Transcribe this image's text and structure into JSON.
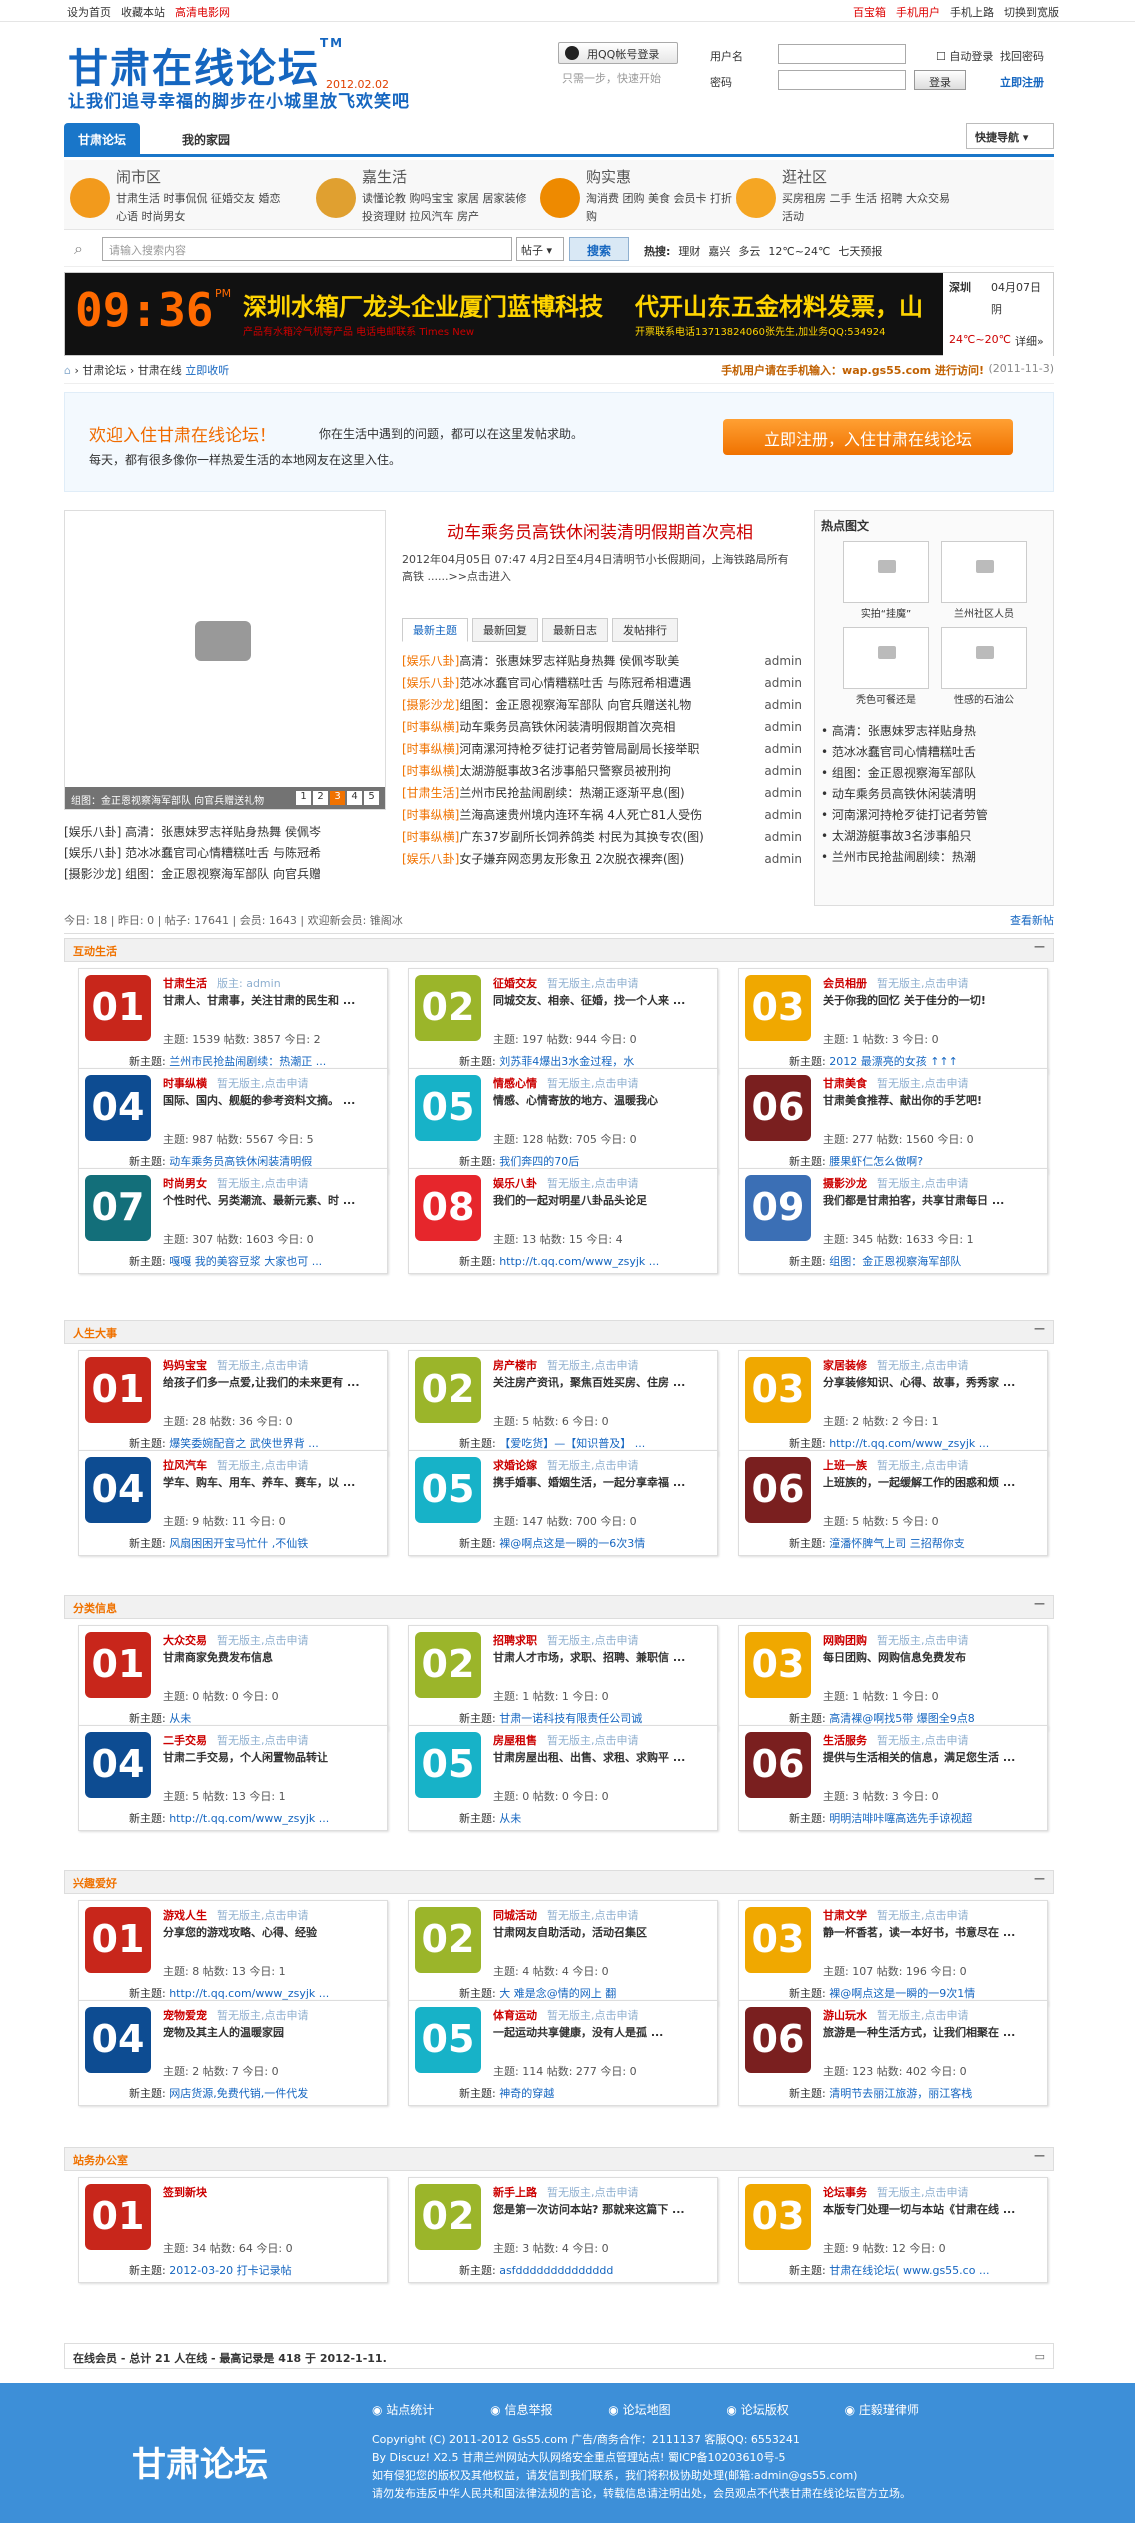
{
  "topbar": {
    "set_home": "设为首页",
    "fav": "收藏本站",
    "movie": "高清电影网",
    "box": "百宝箱",
    "mobile": "手机用户",
    "hand": "手机上路",
    "wide": "切换到宽版"
  },
  "header": {
    "logo": "甘肃在线论坛",
    "tm": "TM",
    "date": "2012.02.02",
    "slogan": "让我们追寻幸福的脚步在小城里放飞欢笑吧",
    "qq_btn": "用QQ帐号登录",
    "qq_sub": "只需一步，快速开始",
    "user_label": "用户名",
    "pwd_label": "密码",
    "auto": "自动登录",
    "find_pwd": "找回密码",
    "login": "登录",
    "register": "立即注册"
  },
  "nav": {
    "tab1": "甘肃论坛",
    "tab2": "我的家园",
    "quick": "快捷导航"
  },
  "cats": [
    {
      "title": "闹市区",
      "items": "甘肃生活 时事侃侃 征婚交友 婚恋心语 时尚男女"
    },
    {
      "title": "嘉生活",
      "items": "读懂论教 购吗宝宝 家居 居家装修 投资理财 拉风汽车 房产"
    },
    {
      "title": "购实惠",
      "items": "淘消费 团购 美食 会员卡 打折 网购"
    },
    {
      "title": "逛社区",
      "items": "买房租房 二手 生活 招聘 大众交易 活动"
    }
  ],
  "search": {
    "placeholder": "请输入搜索内容",
    "select": "帖子",
    "button": "搜索",
    "hot_label": "热搜:",
    "hot": [
      "理财",
      "嘉兴",
      "多云",
      "12℃~24℃",
      "七天预报"
    ]
  },
  "banner": {
    "clock": "09:36",
    "pm": "PM",
    "t1": "深圳水箱厂龙头企业厦门蓝博科技",
    "t2": "产品有水箱冷气机等产品 电话电邮联系 Times New",
    "t3": "代开山东五金材料发票，山",
    "t4": "开票联系电话13713824060张先生,加业务QQ:534924",
    "weather_city": "深圳",
    "weather_date": "04月07日",
    "weather": "阴",
    "temp": "24℃~20℃",
    "detail": "详细»"
  },
  "crumb": {
    "home": "甘肃论坛",
    "forum": "甘肃在线",
    "fav": "立即收听",
    "mobile": "手机用户请在手机输入：wap.gs55.com 进行访问!",
    "date": "(2011-11-3)"
  },
  "welcome": {
    "w1": "欢迎入住甘肃在线论坛！",
    "w2": "你在生活中遇到的问题，都可以在这里发帖求助。",
    "w3": "每天，都有很多像你一样热爱生活的本地网友在这里入住。",
    "reg": "立即注册，入住甘肃在线论坛"
  },
  "slide": {
    "cap": "组图：金正恩视察海军部队 向官兵赠送礼物",
    "pages": [
      "1",
      "2",
      "3",
      "4",
      "5"
    ],
    "list": [
      "[娱乐八卦] 高清：张惠妹罗志祥贴身热舞 侯佩岑",
      "[娱乐八卦] 范冰冰蠢官司心情糟糕吐舌 与陈冠希",
      "[摄影沙龙] 组图：金正恩视察海军部队 向官兵赠"
    ]
  },
  "mid": {
    "headline": "动车乘务员高铁休闲装清明假期首次亮相",
    "desc": "2012年04月05日 07:47 4月2日至4月4日清明节小长假期间，上海铁路局所有高铁 ......>>点击进入",
    "tabs": [
      "最新主题",
      "最新回复",
      "最新日志",
      "发帖排行"
    ],
    "list": [
      {
        "tag": "[娱乐八卦]",
        "t": "高清：张惠妹罗志祥贴身热舞 侯佩岑耿美",
        "a": "admin"
      },
      {
        "tag": "[娱乐八卦]",
        "t": "范冰冰蠢官司心情糟糕吐舌 与陈冠希相遭遇",
        "a": "admin"
      },
      {
        "tag": "[摄影沙龙]",
        "t": "组图：金正恩视察海军部队 向官兵赠送礼物",
        "a": "admin"
      },
      {
        "tag": "[时事纵横]",
        "t": "动车乘务员高铁休闲装清明假期首次亮相",
        "a": "admin"
      },
      {
        "tag": "[时事纵横]",
        "t": "河南漯河持枪歹徒打记者劳管局副局长接举职",
        "a": "admin"
      },
      {
        "tag": "[时事纵横]",
        "t": "太湖游艇事故3名涉事船只警察员被刑拘",
        "a": "admin"
      },
      {
        "tag": "[甘肃生活]",
        "t": "兰州市民抢盐闹剧续：热潮正逐渐平息(图)",
        "a": "admin"
      },
      {
        "tag": "[时事纵横]",
        "t": "兰海高速贵州境内连环车祸 4人死亡81人受伤",
        "a": "admin"
      },
      {
        "tag": "[时事纵横]",
        "t": "广东37岁副所长饲养鸽类 村民为其换专农(图)",
        "a": "admin"
      },
      {
        "tag": "[娱乐八卦]",
        "t": "女子嫌弃网恋男友形象丑 2次脱衣裸奔(图)",
        "a": "admin"
      }
    ]
  },
  "right": {
    "title": "热点图文",
    "thumbs": [
      "实拍“挂魔”",
      "兰州社区人员",
      "秃色可餐还是",
      "性感的石油公"
    ],
    "list": [
      "高清：张惠妹罗志祥贴身热",
      "范冰冰蠢官司心情糟糕吐舌",
      "组图：金正恩视察海军部队",
      "动车乘务员高铁休闲装清明",
      "河南漯河持枪歹徒打记者劳管",
      "太湖游艇事故3名涉事船只",
      "兰州市民抢盐闹剧续：热潮"
    ]
  },
  "stat": {
    "text": "今日: 18 | 昨日: 0 | 帖子: 17641 | 会员: 1643 | 欢迎新会员: 锥阁冰",
    "new": "查看新帖"
  },
  "sections": [
    {
      "title": "互动生活",
      "cards": [
        {
          "n": "01",
          "name": "甘肃生活",
          "mod": "版主: admin",
          "desc": "甘肃人、甘肃事，关注甘肃的民生和 ...",
          "stat": "主题: 1539 帖数: 3857 今日: 2",
          "new": "兰州市民抢盐闹剧续：热潮正 ..."
        },
        {
          "n": "02",
          "name": "征婚交友",
          "mod": "暂无版主,点击申请",
          "desc": "同城交友、相亲、征婚，找一个人来 ...",
          "stat": "主题: 197 帖数: 944 今日: 0",
          "new": "刘苏菲4爆出3水金过程，水"
        },
        {
          "n": "03",
          "name": "会员相册",
          "mod": "暂无版主,点击申请",
          "desc": "关于你我的回忆 关于佳分的一切!",
          "stat": "主题: 1 帖数: 3 今日: 0",
          "new": "2012 最漂亮的女孩 ↑↑↑"
        },
        {
          "n": "04",
          "name": "时事纵横",
          "mod": "暂无版主,点击申请",
          "desc": "国际、国内、舰艇的参考资料文摘。 ...",
          "stat": "主题: 987 帖数: 5567 今日: 5",
          "new": "动车乘务员高铁休闲装清明假"
        },
        {
          "n": "05",
          "name": "情感心情",
          "mod": "暂无版主,点击申请",
          "desc": "情感、心情寄放的地方、温暖我心",
          "stat": "主题: 128 帖数: 705 今日: 0",
          "new": "我们奔四的70后"
        },
        {
          "n": "06",
          "name": "甘肃美食",
          "mod": "暂无版主,点击申请",
          "desc": "甘肃美食推荐、献出你的手艺吧!",
          "stat": "主题: 277 帖数: 1560 今日: 0",
          "new": "腰果虾仁怎么做啊?"
        },
        {
          "n": "07",
          "name": "时尚男女",
          "mod": "暂无版主,点击申请",
          "desc": "个性时代、另类潮流、最新元素、时 ...",
          "stat": "主题: 307 帖数: 1603 今日: 0",
          "new": "嘎嘎 我的美容豆浆 大家也可 ..."
        },
        {
          "n": "08",
          "name": "娱乐八卦",
          "mod": "暂无版主,点击申请",
          "desc": "我们的一起对明星八卦品头论足",
          "stat": "主题: 13 帖数: 15 今日: 4",
          "new": "http://t.qq.com/www_zsyjk ..."
        },
        {
          "n": "09",
          "name": "摄影沙龙",
          "mod": "暂无版主,点击申请",
          "desc": "我们都是甘肃拍客，共享甘肃每日 ...",
          "stat": "主题: 345 帖数: 1633 今日: 1",
          "new": "组图：金正恩视察海军部队"
        }
      ]
    },
    {
      "title": "人生大事",
      "cards": [
        {
          "n": "01",
          "name": "妈妈宝宝",
          "mod": "暂无版主,点击申请",
          "desc": "给孩子们多一点爱,让我们的未来更有 ...",
          "stat": "主题: 28 帖数: 36 今日: 0",
          "new": "爆笑委婉配音之 武侠世界背 ..."
        },
        {
          "n": "02",
          "name": "房产楼市",
          "mod": "暂无版主,点击申请",
          "desc": "关注房产资讯，聚焦百姓买房、住房 ...",
          "stat": "主题: 5 帖数: 6 今日: 0",
          "new": "【爱吃货】—【知识普及】 ..."
        },
        {
          "n": "03",
          "name": "家居装修",
          "mod": "暂无版主,点击申请",
          "desc": "分享装修知识、心得、故事，秀秀家 ...",
          "stat": "主题: 2 帖数: 2 今日: 1",
          "new": "http://t.qq.com/www_zsyjk ..."
        },
        {
          "n": "04",
          "name": "拉风汽车",
          "mod": "暂无版主,点击申请",
          "desc": "学车、购车、用车、养车、赛车，以 ...",
          "stat": "主题: 9 帖数: 11 今日: 0",
          "new": "风扇困困开宝马忙什 ,不仙铁"
        },
        {
          "n": "05",
          "name": "求婚论嫁",
          "mod": "暂无版主,点击申请",
          "desc": "携手婚事、婚姻生活，一起分享幸福 ...",
          "stat": "主题: 147 帖数: 700 今日: 0",
          "new": "裸@啊点这是一瞬的一6次3情"
        },
        {
          "n": "06",
          "name": "上班一族",
          "mod": "暂无版主,点击申请",
          "desc": "上班族的，一起缓解工作的困惑和烦 ...",
          "stat": "主题: 5 帖数: 5 今日: 0",
          "new": "潼潘怀脾气上司 三招帮你支"
        }
      ]
    },
    {
      "title": "分类信息",
      "cards": [
        {
          "n": "01",
          "name": "大众交易",
          "mod": "暂无版主,点击申请",
          "desc": "甘肃商家免费发布信息",
          "stat": "主题: 0 帖数: 0 今日: 0",
          "new": "从未"
        },
        {
          "n": "02",
          "name": "招聘求职",
          "mod": "暂无版主,点击申请",
          "desc": "甘肃人才市场，求职、招聘、兼职信 ...",
          "stat": "主题: 1 帖数: 1 今日: 0",
          "new": "甘肃一诺科技有限责任公司诚"
        },
        {
          "n": "03",
          "name": "网购团购",
          "mod": "暂无版主,点击申请",
          "desc": "每日团购、网购信息免费发布",
          "stat": "主题: 1 帖数: 1 今日: 0",
          "new": "高清裸@啊找5带 爆图全9点8"
        },
        {
          "n": "04",
          "name": "二手交易",
          "mod": "暂无版主,点击申请",
          "desc": "甘肃二手交易，个人闲置物品转让",
          "stat": "主题: 5 帖数: 13 今日: 1",
          "new": "http://t.qq.com/www_zsyjk ..."
        },
        {
          "n": "05",
          "name": "房屋租售",
          "mod": "暂无版主,点击申请",
          "desc": "甘肃房屋出租、出售、求租、求购平 ...",
          "stat": "主题: 0 帖数: 0 今日: 0",
          "new": "从未"
        },
        {
          "n": "06",
          "name": "生活服务",
          "mod": "暂无版主,点击申请",
          "desc": "提供与生活相关的信息，满足您生活 ...",
          "stat": "主题: 3 帖数: 3 今日: 0",
          "new": "明明洁啡咔噻高选先手谅视超"
        }
      ]
    },
    {
      "title": "兴趣爱好",
      "cards": [
        {
          "n": "01",
          "name": "游戏人生",
          "mod": "暂无版主,点击申请",
          "desc": "分享您的游戏攻略、心得、经验",
          "stat": "主题: 8 帖数: 13 今日: 1",
          "new": "http://t.qq.com/www_zsyjk ..."
        },
        {
          "n": "02",
          "name": "同城活动",
          "mod": "暂无版主,点击申请",
          "desc": "甘肃网友自助活动，活动召集区",
          "stat": "主题: 4 帖数: 4 今日: 0",
          "new": "大 难是念@情的网上 翻"
        },
        {
          "n": "03",
          "name": "甘肃文学",
          "mod": "暂无版主,点击申请",
          "desc": "静一杯香茗，读一本好书，书意尽在 ...",
          "stat": "主题: 107 帖数: 196 今日: 0",
          "new": "裸@啊点这是一瞬的一9次1情"
        },
        {
          "n": "04",
          "name": "宠物爱宠",
          "mod": "暂无版主,点击申请",
          "desc": "宠物及其主人的温暖家园",
          "stat": "主题: 2 帖数: 7 今日: 0",
          "new": "网店货源,免费代销,一件代发"
        },
        {
          "n": "05",
          "name": "体育运动",
          "mod": "暂无版主,点击申请",
          "desc": "一起运动共享健康，没有人是孤 ...",
          "stat": "主题: 114 帖数: 277 今日: 0",
          "new": "神奇的穿越"
        },
        {
          "n": "06",
          "name": "游山玩水",
          "mod": "暂无版主,点击申请",
          "desc": "旅游是一种生活方式，让我们相聚在 ...",
          "stat": "主题: 123 帖数: 402 今日: 0",
          "new": "清明节去丽江旅游，丽江客栈"
        }
      ]
    },
    {
      "title": "站务办公室",
      "cards": [
        {
          "n": "01",
          "name": "签到新块",
          "mod": "",
          "desc": "",
          "stat": "主题: 34 帖数: 64 今日: 0",
          "new": "2012-03-20 打卡记录帖"
        },
        {
          "n": "02",
          "name": "新手上路",
          "mod": "暂无版主,点击申请",
          "desc": "您是第一次访问本站? 那就来这篇下 ...",
          "stat": "主题: 3 帖数: 4 今日: 0",
          "new": "asfdddddddddddddd"
        },
        {
          "n": "03",
          "name": "论坛事务",
          "mod": "暂无版主,点击申请",
          "desc": "本版专门处理一切与本站《甘肃在线 ...",
          "stat": "主题: 9 帖数: 12 今日: 0",
          "new": "甘肃在线论坛( www.gs55.co ..."
        }
      ]
    }
  ],
  "online": {
    "text": "在线会员 - 总计 21 人在线 - 最高记录是 418 于 2012-1-11."
  },
  "footer": {
    "logo": "甘肃论坛",
    "links": [
      "站点统计",
      "信息举报",
      "论坛地图",
      "论坛版权",
      "庄毅瑾律师"
    ],
    "l1": "Copyright (C) 2011-2012 GsS5.com 广告/商务合作：2111137 客服QQ: 6553241",
    "l2": "By Discuz! X2.5 甘肃兰州网站大队网络安全重点管理站点! 蜀ICP备10203610号-5",
    "l3": "如有侵犯您的版权及其他权益，请发信到我们联系，我们将积极协助处理(邮箱:admin@gs55.com)",
    "l4": "请勿发布违反中华人民共和国法律法规的言论，转载信息请注明出处，会员观点不代表甘肃在线论坛官方立场。"
  }
}
